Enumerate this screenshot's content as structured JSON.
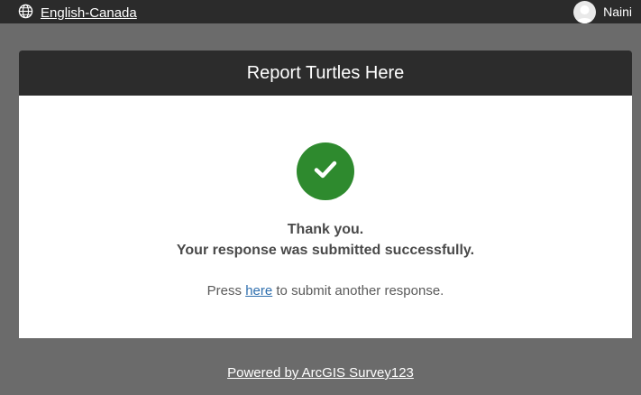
{
  "topbar": {
    "language_label": "English-Canada",
    "language_icon": "globe-icon",
    "user_name": "Naini",
    "avatar_icon": "user-avatar-icon"
  },
  "survey": {
    "title": "Report Turtles Here",
    "success_icon": "checkmark-icon",
    "success_color": "#2e8a2e",
    "thank_you": "Thank you.",
    "submitted_message": "Your response was submitted successfully.",
    "again_prefix": "Press ",
    "again_link": "here",
    "again_suffix": " to submit another response."
  },
  "footer": {
    "powered_by": "Powered by ArcGIS Survey123"
  }
}
